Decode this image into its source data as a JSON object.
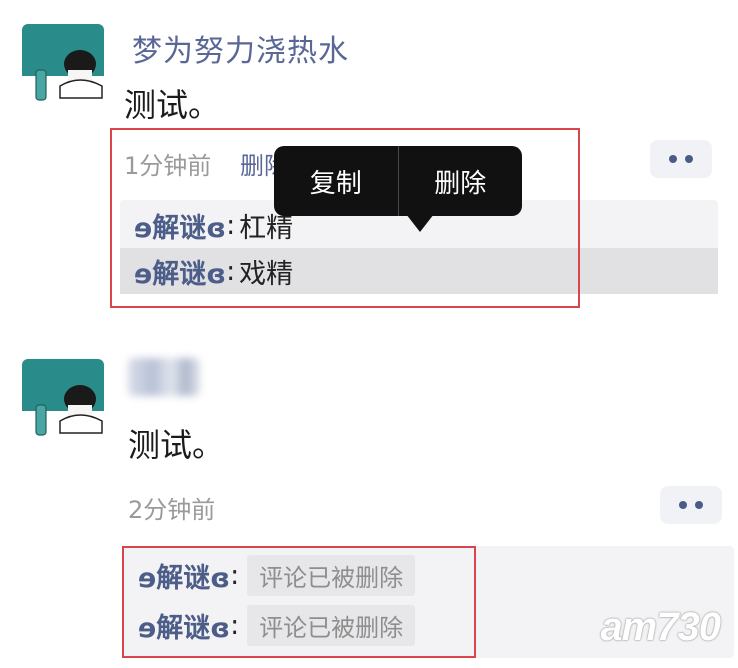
{
  "post1": {
    "author": "梦为努力浇热水",
    "content": "测试。",
    "timestamp": "1分钟前",
    "inline_delete": "删除",
    "comments": [
      {
        "name": "ɘ解谜ɞ",
        "sep": ":",
        "text": "杠精"
      },
      {
        "name": "ɘ解谜ɞ",
        "sep": ":",
        "text": "戏精"
      }
    ],
    "popup": {
      "copy": "复制",
      "delete": "删除"
    }
  },
  "post2": {
    "content": "测试。",
    "timestamp": "2分钟前",
    "comments": [
      {
        "name": "ɘ解谜ɞ",
        "sep": ":",
        "text": "评论已被删除"
      },
      {
        "name": "ɘ解谜ɞ",
        "sep": ":",
        "text": "评论已被删除"
      }
    ]
  },
  "watermark": "am730",
  "icons": {
    "avatar": "anime-avatar-icon",
    "more": "more-dots-icon"
  },
  "colors": {
    "link": "#5a6796",
    "highlight_box": "#d9454a",
    "popup_bg": "#111111"
  }
}
